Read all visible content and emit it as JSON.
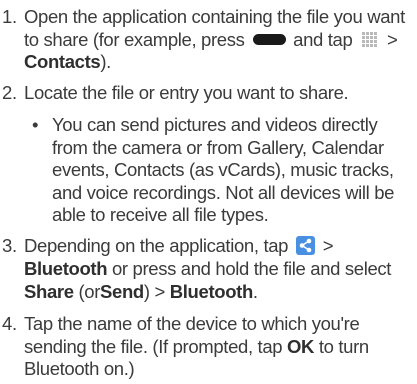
{
  "steps": [
    {
      "num": "1.",
      "part1": "Open the application containing the file you want to share (for example, press",
      "part2": "and tap",
      "part3": ">",
      "contacts": "Contacts",
      "part4": ")."
    },
    {
      "num": "2.",
      "text": "Locate the file or entry you want to share."
    },
    {
      "num": "3.",
      "part1": "Depending on the application, tap",
      "gt1": ">",
      "bluetooth1": "Bluetooth",
      "part2": "or press and hold the file and select",
      "share": "Share",
      "part3": "(or",
      "send": "Send",
      "part4": ")",
      "gt2": ">",
      "bluetooth2": "Bluetooth",
      "part5": "."
    },
    {
      "num": "4.",
      "part1": "Tap the name of the device to which you're sending the file. (If prompted, tap",
      "ok": "OK",
      "part2": "to turn Bluetooth on.)"
    }
  ],
  "bullet": {
    "symbol": "•",
    "text": "You can send pictures and videos directly from the camera or from Gallery, Calendar events, Contacts (as vCards), music tracks, and voice recordings. Not all devices will be able to receive all file types."
  },
  "icons": {
    "home_key": "home-key-icon",
    "apps": "apps-grid-icon",
    "share": "share-icon",
    "share_color": "#4a90e2"
  }
}
